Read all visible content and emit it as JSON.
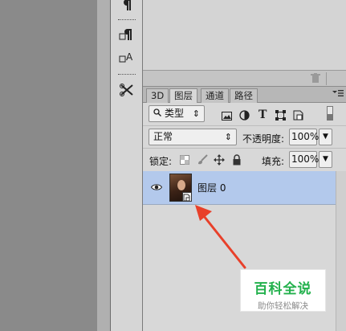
{
  "panel": {
    "tabs": [
      {
        "label": "3D"
      },
      {
        "label": "图层"
      },
      {
        "label": "通道"
      },
      {
        "label": "路径"
      }
    ],
    "menu_icon": "panel-menu-icon"
  },
  "filter": {
    "kind_label": "类型",
    "arrows": "⇕"
  },
  "blend": {
    "mode": "正常",
    "opacity_label": "不透明度:",
    "opacity_value": "100%"
  },
  "lock": {
    "label": "锁定:",
    "fill_label": "填充:",
    "fill_value": "100%"
  },
  "layers": [
    {
      "name": "图层 0",
      "visible": true,
      "selected": true,
      "smart_object": true
    }
  ],
  "watermark": {
    "brand": "百科全说",
    "tagline": "助你轻松解决"
  },
  "colors": {
    "selected_row": "#b3c9ec",
    "arrow": "#e8402a",
    "brand_green": "#23b14d"
  }
}
